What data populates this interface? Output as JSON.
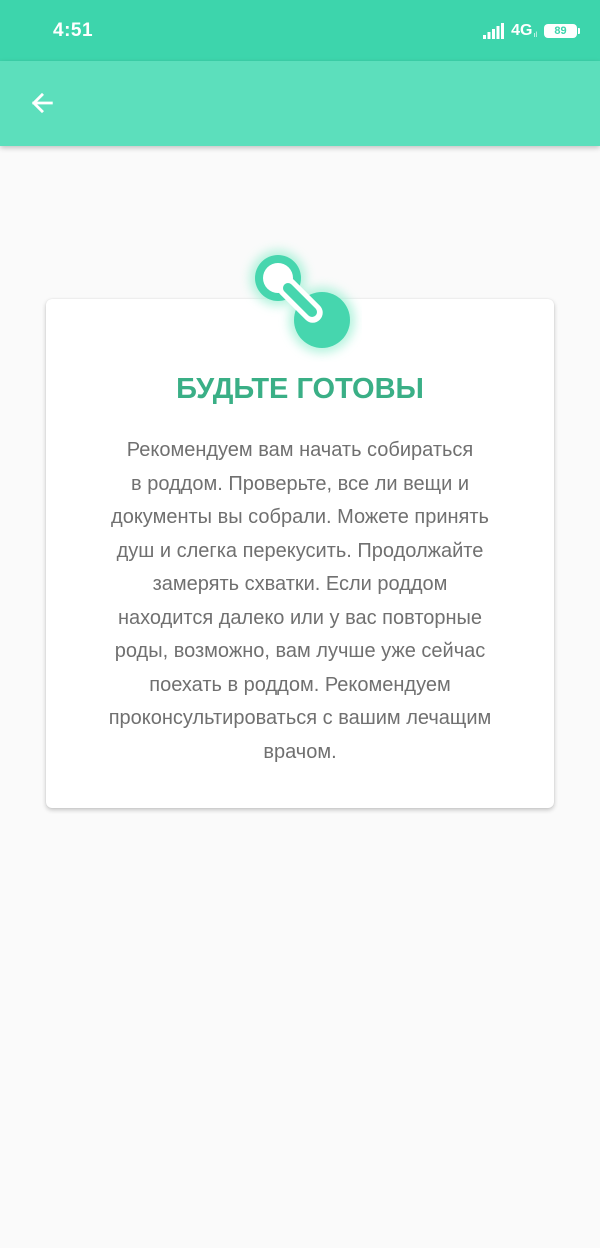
{
  "status_bar": {
    "time": "4:51",
    "network": "4G",
    "network_sub": "ıl",
    "battery": "89",
    "signal_icon": "signal-icon"
  },
  "app_bar": {
    "back_icon": "arrow-left-icon"
  },
  "card": {
    "icon": "pacifier-icon",
    "title": "БУДЬТЕ ГОТОВЫ",
    "body": "Рекомендуем вам начать собираться\nв роддом. Проверьте, все ли вещи и\nдокументы вы собрали. Можете принять\nдуш и слегка перекусить. Продолжайте\nзамерять схватки. Если роддом\nнаходится далеко или у вас повторные\nроды, возможно, вам лучше уже сейчас\nпоехать в роддом. Рекомендуем\nпроконсультироваться с вашим лечащим\nврачом."
  },
  "colors": {
    "status_bar": "#3dd5ac",
    "app_bar": "#5cdfbc",
    "accent_title": "#3aaf86",
    "icon_fill": "#46d6ae",
    "background": "#fafafa",
    "body_text": "#707070"
  }
}
